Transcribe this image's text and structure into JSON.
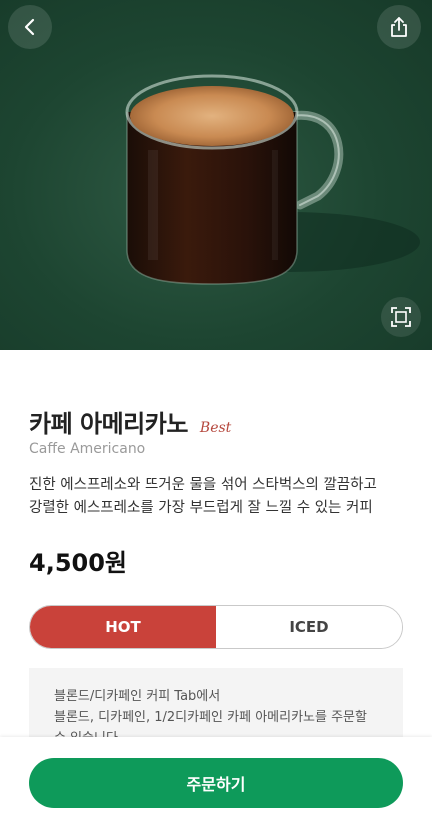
{
  "product": {
    "name": "카페 아메리카노",
    "badge": "Best",
    "english_name": "Caffe Americano",
    "description_lines": [
      "진한 에스프레소와 뜨거운 물을 섞어 스타벅스의 깔끔하고",
      "강렬한 에스프레소를 가장 부드럽게 잘 느낄 수 있는 커피"
    ],
    "price": "4,500원"
  },
  "temperature": {
    "options": [
      "HOT",
      "ICED"
    ],
    "selected": "HOT"
  },
  "info": {
    "lines": [
      "블론드/디카페인 커피 Tab에서",
      "블론드, 디카페인, 1/2디카페인 카페 아메리카노를 주문할",
      "수 있습니다."
    ]
  },
  "actions": {
    "order_label": "주문하기"
  },
  "icons": {
    "back": "chevron-left-icon",
    "share": "share-icon",
    "expand": "expand-icon"
  },
  "colors": {
    "hero_background": "#1d4531",
    "accent_red": "#c9423a",
    "order_green": "#0e9a5a",
    "badge_red": "#b5473d"
  }
}
